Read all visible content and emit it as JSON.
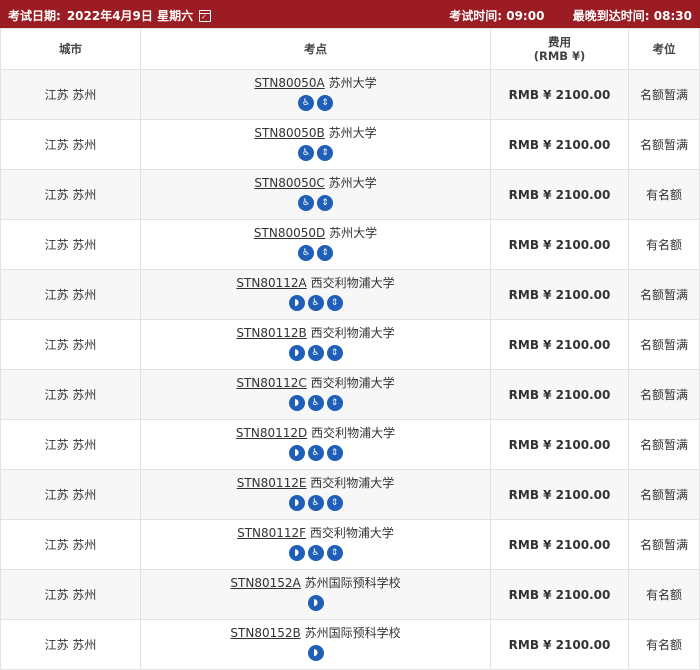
{
  "header": {
    "date_label": "考试日期:",
    "date_value": "2022年4月9日 星期六",
    "exam_time_label": "考试时间:",
    "exam_time_value": "09:00",
    "latest_arrival_label": "最晚到达时间:",
    "latest_arrival_value": "08:30"
  },
  "table": {
    "columns": {
      "city": "城市",
      "center": "考点",
      "fee_line1": "费用",
      "fee_line2": "(RMB ¥)",
      "seat": "考位"
    },
    "rows": [
      {
        "city": "江苏 苏州",
        "code": "STN80050A",
        "name": "苏州大学",
        "icons": [
          "wheelchair-icon",
          "elevator-icon"
        ],
        "fee": "RMB ¥ 2100.00",
        "seat": "名额暂满"
      },
      {
        "city": "江苏 苏州",
        "code": "STN80050B",
        "name": "苏州大学",
        "icons": [
          "wheelchair-icon",
          "elevator-icon"
        ],
        "fee": "RMB ¥ 2100.00",
        "seat": "名额暂满"
      },
      {
        "city": "江苏 苏州",
        "code": "STN80050C",
        "name": "苏州大学",
        "icons": [
          "wheelchair-icon",
          "elevator-icon"
        ],
        "fee": "RMB ¥ 2100.00",
        "seat": "有名额"
      },
      {
        "city": "江苏 苏州",
        "code": "STN80050D",
        "name": "苏州大学",
        "icons": [
          "wheelchair-icon",
          "elevator-icon"
        ],
        "fee": "RMB ¥ 2100.00",
        "seat": "有名额"
      },
      {
        "city": "江苏 苏州",
        "code": "STN80112A",
        "name": "西交利物浦大学",
        "icons": [
          "hearing-icon",
          "wheelchair-icon",
          "elevator-icon"
        ],
        "fee": "RMB ¥ 2100.00",
        "seat": "名额暂满"
      },
      {
        "city": "江苏 苏州",
        "code": "STN80112B",
        "name": "西交利物浦大学",
        "icons": [
          "hearing-icon",
          "wheelchair-icon",
          "elevator-icon"
        ],
        "fee": "RMB ¥ 2100.00",
        "seat": "名额暂满"
      },
      {
        "city": "江苏 苏州",
        "code": "STN80112C",
        "name": "西交利物浦大学",
        "icons": [
          "hearing-icon",
          "wheelchair-icon",
          "elevator-icon"
        ],
        "fee": "RMB ¥ 2100.00",
        "seat": "名额暂满"
      },
      {
        "city": "江苏 苏州",
        "code": "STN80112D",
        "name": "西交利物浦大学",
        "icons": [
          "hearing-icon",
          "wheelchair-icon",
          "elevator-icon"
        ],
        "fee": "RMB ¥ 2100.00",
        "seat": "名额暂满"
      },
      {
        "city": "江苏 苏州",
        "code": "STN80112E",
        "name": "西交利物浦大学",
        "icons": [
          "hearing-icon",
          "wheelchair-icon",
          "elevator-icon"
        ],
        "fee": "RMB ¥ 2100.00",
        "seat": "名额暂满"
      },
      {
        "city": "江苏 苏州",
        "code": "STN80112F",
        "name": "西交利物浦大学",
        "icons": [
          "hearing-icon",
          "wheelchair-icon",
          "elevator-icon"
        ],
        "fee": "RMB ¥ 2100.00",
        "seat": "名额暂满"
      },
      {
        "city": "江苏 苏州",
        "code": "STN80152A",
        "name": "苏州国际预科学校",
        "icons": [
          "hearing-icon"
        ],
        "fee": "RMB ¥ 2100.00",
        "seat": "有名额"
      },
      {
        "city": "江苏 苏州",
        "code": "STN80152B",
        "name": "苏州国际预科学校",
        "icons": [
          "hearing-icon"
        ],
        "fee": "RMB ¥ 2100.00",
        "seat": "有名额"
      }
    ]
  },
  "colors": {
    "header_bg": "#9b1c22",
    "icon_bg": "#1f5fb8"
  }
}
